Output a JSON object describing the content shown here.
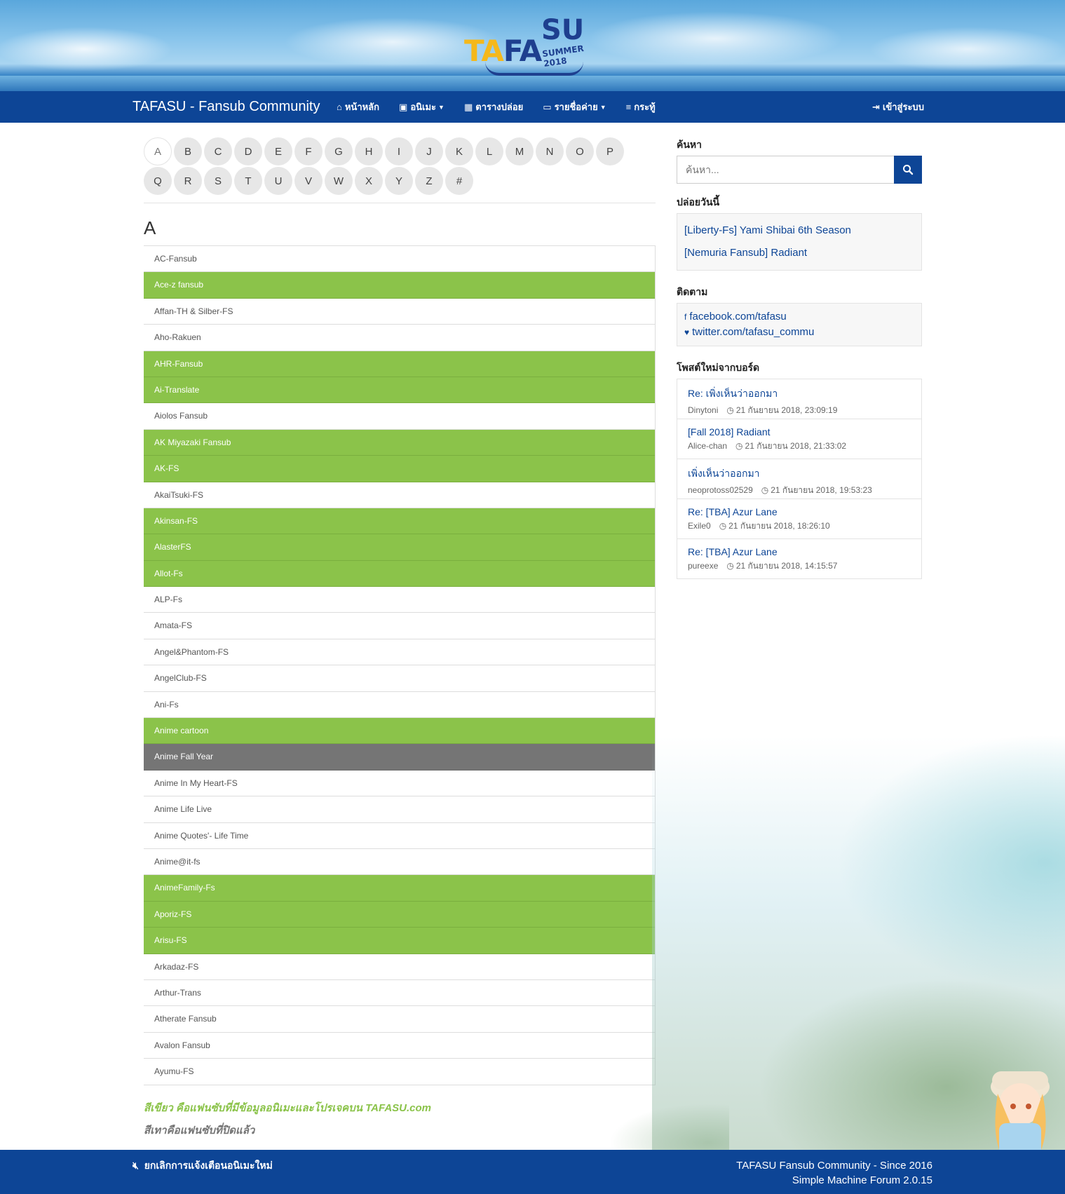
{
  "header": {
    "logo_text_a": "TA",
    "logo_text_b": "FA",
    "logo_text_c": "SU",
    "logo_year": "SUMMER 2018"
  },
  "navbar": {
    "brand": "TAFASU - Fansub Community",
    "items": [
      {
        "label": "หน้าหลัก",
        "icon": "home-icon",
        "glyph": "⌂",
        "dropdown": false
      },
      {
        "label": "อนิเมะ",
        "icon": "film-icon",
        "glyph": "▣",
        "dropdown": true
      },
      {
        "label": "ตารางปล่อย",
        "icon": "calendar-icon",
        "glyph": "▦",
        "dropdown": false
      },
      {
        "label": "รายชื่อค่าย",
        "icon": "folder-open-icon",
        "glyph": "▭",
        "dropdown": true
      },
      {
        "label": "กระทู้",
        "icon": "list-icon",
        "glyph": "≡",
        "dropdown": false
      }
    ],
    "login": "เข้าสู่ระบบ"
  },
  "alphabet": {
    "row1": [
      "A",
      "B",
      "C",
      "D",
      "E",
      "F",
      "G",
      "H",
      "I",
      "J",
      "K",
      "L",
      "M",
      "N",
      "O",
      "P"
    ],
    "row2": [
      "Q",
      "R",
      "S",
      "T",
      "U",
      "V",
      "W",
      "X",
      "Y",
      "Z",
      "#"
    ],
    "active": "A"
  },
  "section_letter": "A",
  "fansubs": [
    {
      "name": "AC-Fansub",
      "status": "normal"
    },
    {
      "name": "Ace-z fansub",
      "status": "green"
    },
    {
      "name": "Affan-TH & Silber-FS",
      "status": "normal"
    },
    {
      "name": "Aho-Rakuen",
      "status": "normal"
    },
    {
      "name": "AHR-Fansub",
      "status": "green"
    },
    {
      "name": "Ai-Translate",
      "status": "green"
    },
    {
      "name": "Aiolos Fansub",
      "status": "normal"
    },
    {
      "name": "AK Miyazaki Fansub",
      "status": "green"
    },
    {
      "name": "AK-FS",
      "status": "green"
    },
    {
      "name": "AkaiTsuki-FS",
      "status": "normal"
    },
    {
      "name": "Akinsan-FS",
      "status": "green"
    },
    {
      "name": "AlasterFS",
      "status": "green"
    },
    {
      "name": "Allot-Fs",
      "status": "green"
    },
    {
      "name": "ALP-Fs",
      "status": "normal"
    },
    {
      "name": "Amata-FS",
      "status": "normal"
    },
    {
      "name": "Angel&Phantom-FS",
      "status": "normal"
    },
    {
      "name": "AngelClub-FS",
      "status": "normal"
    },
    {
      "name": "Ani-Fs",
      "status": "normal"
    },
    {
      "name": "Anime cartoon",
      "status": "green"
    },
    {
      "name": "Anime Fall Year",
      "status": "gray"
    },
    {
      "name": "Anime In My Heart-FS",
      "status": "normal"
    },
    {
      "name": "Anime Life Live",
      "status": "normal"
    },
    {
      "name": "Anime Quotes'- Life Time",
      "status": "normal"
    },
    {
      "name": "Anime@it-fs",
      "status": "normal"
    },
    {
      "name": "AnimeFamily-Fs",
      "status": "green"
    },
    {
      "name": "Aporiz-FS",
      "status": "green"
    },
    {
      "name": "Arisu-FS",
      "status": "green"
    },
    {
      "name": "Arkadaz-FS",
      "status": "normal"
    },
    {
      "name": "Arthur-Trans",
      "status": "normal"
    },
    {
      "name": "Atherate Fansub",
      "status": "normal"
    },
    {
      "name": "Avalon Fansub",
      "status": "normal"
    },
    {
      "name": "Ayumu-FS",
      "status": "normal"
    }
  ],
  "legend": {
    "green": "สีเขียว คือแฟนซับที่มีข้อมูลอนิเมะและโปรเจคบน TAFASU.com",
    "gray": "สีเทาคือแฟนซับที่ปิดแล้ว"
  },
  "sidebar": {
    "search_title": "ค้นหา",
    "search_placeholder": "ค้นหา...",
    "release_title": "ปล่อยวันนี้",
    "releases": [
      "[Liberty-Fs] Yami Shibai 6th Season",
      "[Nemuria Fansub] Radiant"
    ],
    "follow_title": "ติดตาม",
    "follow": [
      {
        "label": "facebook.com/tafasu",
        "icon": "facebook-icon",
        "glyph": "f"
      },
      {
        "label": "twitter.com/tafasu_commu",
        "icon": "twitter-icon",
        "glyph": "♥"
      }
    ],
    "posts_title": "โพสต์ใหม่จากบอร์ด",
    "posts": [
      {
        "title": "Re: เพิ่งเห็นว่าออกมา",
        "author": "Dinytoni",
        "time": "21 กันยายน 2018, 23:09:19"
      },
      {
        "title": "[Fall 2018] Radiant",
        "author": "Alice-chan",
        "time": "21 กันยายน 2018, 21:33:02"
      },
      {
        "title": "เพิ่งเห็นว่าออกมา",
        "author": "neoprotoss02529",
        "time": "21 กันยายน 2018, 19:53:23"
      },
      {
        "title": "Re: [TBA] Azur Lane",
        "author": "Exile0",
        "time": "21 กันยายน 2018, 18:26:10"
      },
      {
        "title": "Re: [TBA] Azur Lane",
        "author": "pureexe",
        "time": "21 กันยายน 2018, 14:15:57"
      }
    ]
  },
  "footer": {
    "mute_label": "ยกเลิกการแจ้งเตือนอนิเมะใหม่",
    "credit_line1": "TAFASU Fansub Community - Since 2016",
    "credit_line2": "Simple Machine Forum 2.0.15"
  },
  "colors": {
    "nav_blue": "#0d4596",
    "green_status": "#8bc34a",
    "gray_status": "#757575"
  }
}
